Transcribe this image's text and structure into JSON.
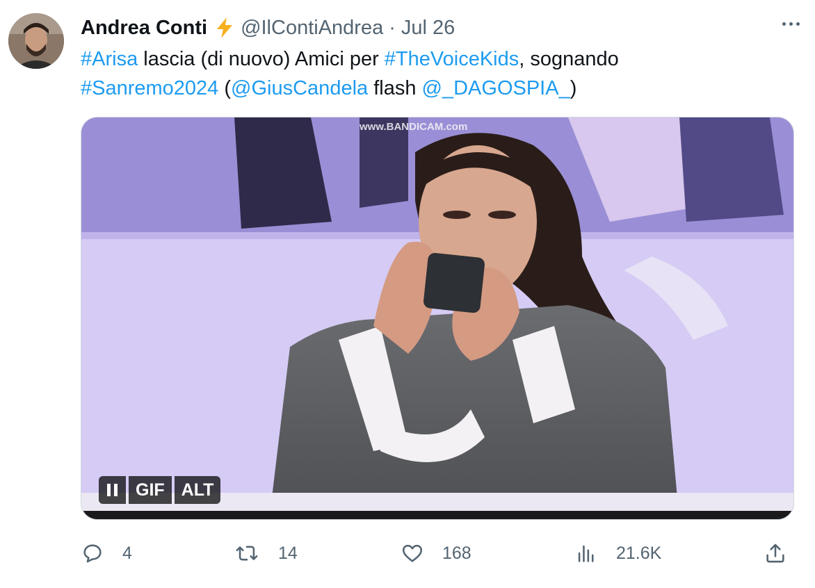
{
  "tweet": {
    "author_name": "Andrea Conti",
    "handle": "@IlContiAndrea",
    "separator": "·",
    "date": "Jul 26",
    "text": {
      "line1": [
        "#Arisa",
        " lascia (di nuovo) Amici per ",
        "#TheVoiceKids",
        ", sognando"
      ],
      "line2": [
        "#Sanremo2024",
        " (",
        "@GiusCandela",
        " flash ",
        "@_DAGOSPIA_",
        ")"
      ]
    },
    "media": {
      "type": "GIF",
      "watermark": "www.BANDICAM.com",
      "controls": {
        "gif_label": "GIF",
        "alt_label": "ALT"
      }
    },
    "actions": {
      "replies": "4",
      "retweets": "14",
      "likes": "168",
      "views": "21.6K"
    }
  },
  "icons": {
    "verified": "lightning-bolt-icon",
    "more": "more-icon",
    "reply": "reply-icon",
    "retweet": "retweet-icon",
    "like": "heart-icon",
    "views": "views-icon",
    "share": "share-icon",
    "pause": "pause-icon"
  },
  "colors": {
    "link": "#1d9bf0",
    "secondary_text": "#536471",
    "primary_text": "#0f1419",
    "bolt": "#f6b01c"
  }
}
